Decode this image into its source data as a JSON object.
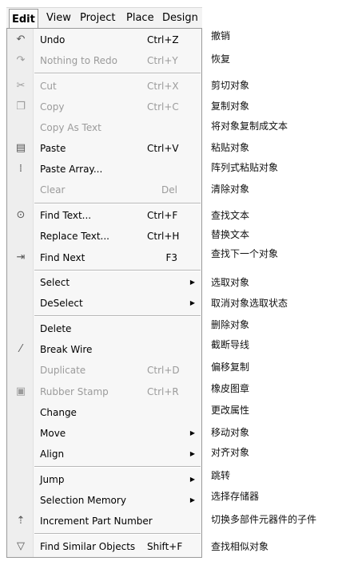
{
  "menubar": {
    "items": [
      {
        "label": "Edit",
        "active": true
      },
      {
        "label": "View"
      },
      {
        "label": "Project"
      },
      {
        "label": "Place"
      },
      {
        "label": "Design"
      }
    ]
  },
  "menu": {
    "items": [
      {
        "label": "Undo",
        "shortcut": "Ctrl+Z",
        "icon": "undo-icon",
        "cn": "撤销"
      },
      {
        "label": "Nothing to Redo",
        "shortcut": "Ctrl+Y",
        "icon": "redo-icon",
        "disabled": true,
        "cn": "恢复"
      },
      {
        "label": "Cut",
        "shortcut": "Ctrl+X",
        "icon": "scissors-icon",
        "disabled": true,
        "cn": "剪切对象"
      },
      {
        "label": "Copy",
        "shortcut": "Ctrl+C",
        "icon": "copy-icon",
        "disabled": true,
        "cn": "复制对象"
      },
      {
        "label": "Copy As Text",
        "shortcut": "",
        "disabled": true,
        "cn": "将对象复制成文本"
      },
      {
        "label": "Paste",
        "shortcut": "Ctrl+V",
        "icon": "paste-icon",
        "cn": "粘贴对象"
      },
      {
        "label": "Paste Array...",
        "shortcut": "",
        "icon": "paste-array-icon",
        "cn": "阵列式粘贴对象"
      },
      {
        "label": "Clear",
        "shortcut": "Del",
        "disabled": true,
        "cn": "清除对象"
      },
      {
        "label": "Find Text...",
        "shortcut": "Ctrl+F",
        "icon": "binoculars-icon",
        "cn": "查找文本"
      },
      {
        "label": "Replace Text...",
        "shortcut": "Ctrl+H",
        "cn": "替换文本"
      },
      {
        "label": "Find Next",
        "shortcut": "F3",
        "icon": "find-next-icon",
        "cn": "查找下一个对象"
      },
      {
        "label": "Select",
        "submenu": true,
        "cn": "选取对象"
      },
      {
        "label": "DeSelect",
        "submenu": true,
        "cn": "取消对象选取状态"
      },
      {
        "label": "Delete",
        "shortcut": "",
        "cn": "删除对象"
      },
      {
        "label": "Break Wire",
        "shortcut": "",
        "icon": "break-wire-icon",
        "cn": "截断导线"
      },
      {
        "label": "Duplicate",
        "shortcut": "Ctrl+D",
        "disabled": true,
        "cn": "偏移复制"
      },
      {
        "label": "Rubber Stamp",
        "shortcut": "Ctrl+R",
        "icon": "stamp-icon",
        "disabled": true,
        "cn": "橡皮图章"
      },
      {
        "label": "Change",
        "shortcut": "",
        "cn": "更改属性"
      },
      {
        "label": "Move",
        "submenu": true,
        "cn": "移动对象"
      },
      {
        "label": "Align",
        "submenu": true,
        "cn": "对齐对象"
      },
      {
        "label": "Jump",
        "submenu": true,
        "cn": "跳转"
      },
      {
        "label": "Selection Memory",
        "submenu": true,
        "cn": "选择存储器"
      },
      {
        "label": "Increment Part Number",
        "shortcut": "",
        "icon": "increment-part-icon",
        "cn": "切换多部件元器件的子件"
      },
      {
        "label": "Find Similar Objects",
        "shortcut": "Shift+F",
        "icon": "funnel-icon",
        "cn": "查找相似对象"
      }
    ]
  }
}
